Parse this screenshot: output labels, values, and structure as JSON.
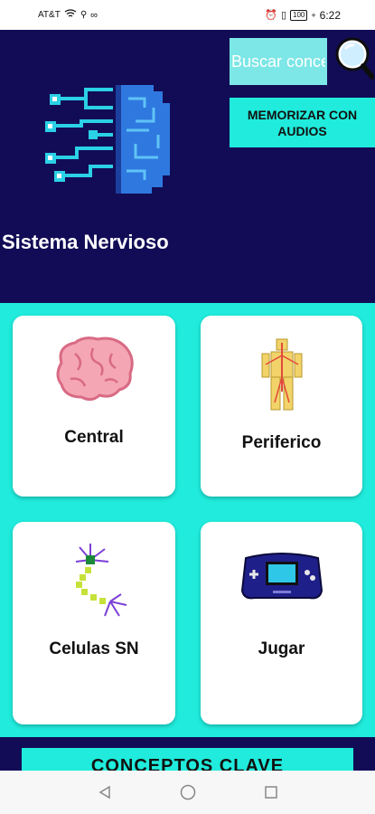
{
  "status_bar": {
    "carrier": "AT&T",
    "battery": "100",
    "time": "6:22"
  },
  "header": {
    "title": "Sistema Nervioso",
    "search_placeholder": "Buscar concepto",
    "memorize_button": "MEMORIZAR CON AUDIOS"
  },
  "cards": [
    {
      "label": "Central",
      "icon": "brain-icon"
    },
    {
      "label": "Periferico",
      "icon": "body-nerves-icon"
    },
    {
      "label": "Celulas SN",
      "icon": "neuron-icon"
    },
    {
      "label": "Jugar",
      "icon": "game-console-icon"
    }
  ],
  "bottom_button": "CONCEPTOS CLAVE",
  "colors": {
    "header_bg": "#120c56",
    "accent": "#20ebdc",
    "search_bg": "#7de6e6"
  }
}
